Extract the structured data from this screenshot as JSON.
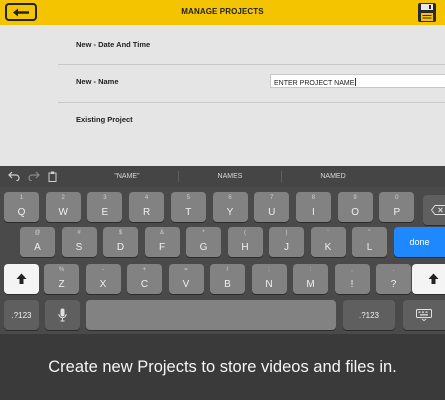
{
  "header": {
    "title": "MANAGE PROJECTS",
    "back_icon": "back-arrow-icon",
    "save_icon": "floppy-disk-icon",
    "accent_color": "#f5c400"
  },
  "content": {
    "rows": [
      {
        "label": "New - Date And Time"
      },
      {
        "label": "New - Name",
        "input_placeholder": "ENTER PROJECT NAME"
      },
      {
        "label": "Existing Project"
      }
    ]
  },
  "keyboard": {
    "toolbar_icons": [
      "undo-icon",
      "redo-icon",
      "paste-icon"
    ],
    "suggestions": [
      "\"NAME\"",
      "NAMES",
      "NAMED"
    ],
    "row1": [
      {
        "main": "Q",
        "alt": "1"
      },
      {
        "main": "W",
        "alt": "2"
      },
      {
        "main": "E",
        "alt": "3"
      },
      {
        "main": "R",
        "alt": "4"
      },
      {
        "main": "T",
        "alt": "5"
      },
      {
        "main": "Y",
        "alt": "6"
      },
      {
        "main": "U",
        "alt": "7"
      },
      {
        "main": "I",
        "alt": "8"
      },
      {
        "main": "O",
        "alt": "9"
      },
      {
        "main": "P",
        "alt": "0"
      }
    ],
    "row2": [
      {
        "main": "A",
        "alt": "@"
      },
      {
        "main": "S",
        "alt": "#"
      },
      {
        "main": "D",
        "alt": "$"
      },
      {
        "main": "F",
        "alt": "&"
      },
      {
        "main": "G",
        "alt": "*"
      },
      {
        "main": "H",
        "alt": "("
      },
      {
        "main": "J",
        "alt": ")"
      },
      {
        "main": "K",
        "alt": "'"
      },
      {
        "main": "L",
        "alt": "\""
      }
    ],
    "row3": [
      {
        "main": "Z",
        "alt": "%"
      },
      {
        "main": "X",
        "alt": "-"
      },
      {
        "main": "C",
        "alt": "+"
      },
      {
        "main": "V",
        "alt": "="
      },
      {
        "main": "B",
        "alt": "/"
      },
      {
        "main": "N",
        "alt": ";"
      },
      {
        "main": "M",
        "alt": ":"
      },
      {
        "main": "!",
        "alt": ","
      },
      {
        "main": "?",
        "alt": "."
      }
    ],
    "done_label": "done",
    "numbers_label": ".?123",
    "done_color": "#1e88ff"
  },
  "caption": {
    "text": "Create new Projects to store videos and files in."
  }
}
